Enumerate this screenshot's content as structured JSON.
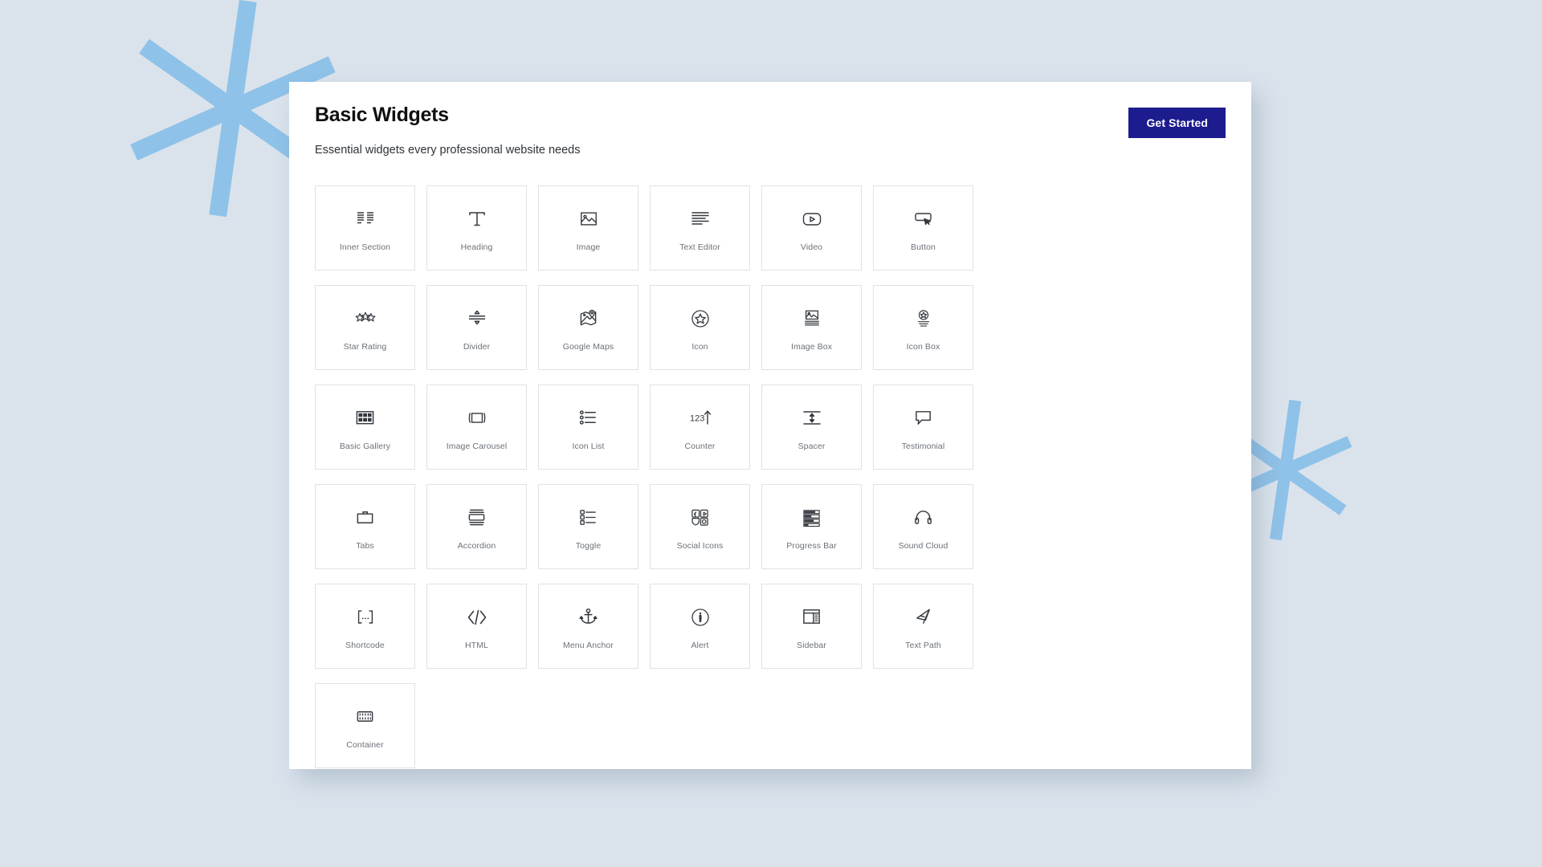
{
  "theme": {
    "page_background": "#dae3ec",
    "panel_background": "#ffffff",
    "accent_button": "#1c1c8f",
    "decoration_color": "#8fc2e8",
    "card_border": "#e0e2e5",
    "label_color": "#6b7178"
  },
  "header": {
    "title": "Basic Widgets",
    "subtitle": "Essential widgets every professional website needs",
    "cta_label": "Get Started"
  },
  "widgets": [
    {
      "label": "Inner Section",
      "icon": "inner-section-icon"
    },
    {
      "label": "Heading",
      "icon": "heading-icon"
    },
    {
      "label": "Image",
      "icon": "image-icon"
    },
    {
      "label": "Text Editor",
      "icon": "text-editor-icon"
    },
    {
      "label": "Video",
      "icon": "video-icon"
    },
    {
      "label": "Button",
      "icon": "button-icon"
    },
    {
      "label": "Star Rating",
      "icon": "star-rating-icon"
    },
    {
      "label": "Divider",
      "icon": "divider-icon"
    },
    {
      "label": "Google Maps",
      "icon": "google-maps-icon"
    },
    {
      "label": "Icon",
      "icon": "icon-star-circle-icon"
    },
    {
      "label": "Image Box",
      "icon": "image-box-icon"
    },
    {
      "label": "Icon Box",
      "icon": "icon-box-icon"
    },
    {
      "label": "Basic Gallery",
      "icon": "basic-gallery-icon"
    },
    {
      "label": "Image Carousel",
      "icon": "image-carousel-icon"
    },
    {
      "label": "Icon List",
      "icon": "icon-list-icon"
    },
    {
      "label": "Counter",
      "icon": "counter-icon"
    },
    {
      "label": "Spacer",
      "icon": "spacer-icon"
    },
    {
      "label": "Testimonial",
      "icon": "testimonial-icon"
    },
    {
      "label": "Tabs",
      "icon": "tabs-icon"
    },
    {
      "label": "Accordion",
      "icon": "accordion-icon"
    },
    {
      "label": "Toggle",
      "icon": "toggle-icon"
    },
    {
      "label": "Social Icons",
      "icon": "social-icons-icon"
    },
    {
      "label": "Progress Bar",
      "icon": "progress-bar-icon"
    },
    {
      "label": "Sound Cloud",
      "icon": "sound-cloud-icon"
    },
    {
      "label": "Shortcode",
      "icon": "shortcode-icon"
    },
    {
      "label": "HTML",
      "icon": "html-icon"
    },
    {
      "label": "Menu Anchor",
      "icon": "menu-anchor-icon"
    },
    {
      "label": "Alert",
      "icon": "alert-icon"
    },
    {
      "label": "Sidebar",
      "icon": "sidebar-icon"
    },
    {
      "label": "Text Path",
      "icon": "text-path-icon"
    },
    {
      "label": "Container",
      "icon": "container-icon"
    }
  ]
}
